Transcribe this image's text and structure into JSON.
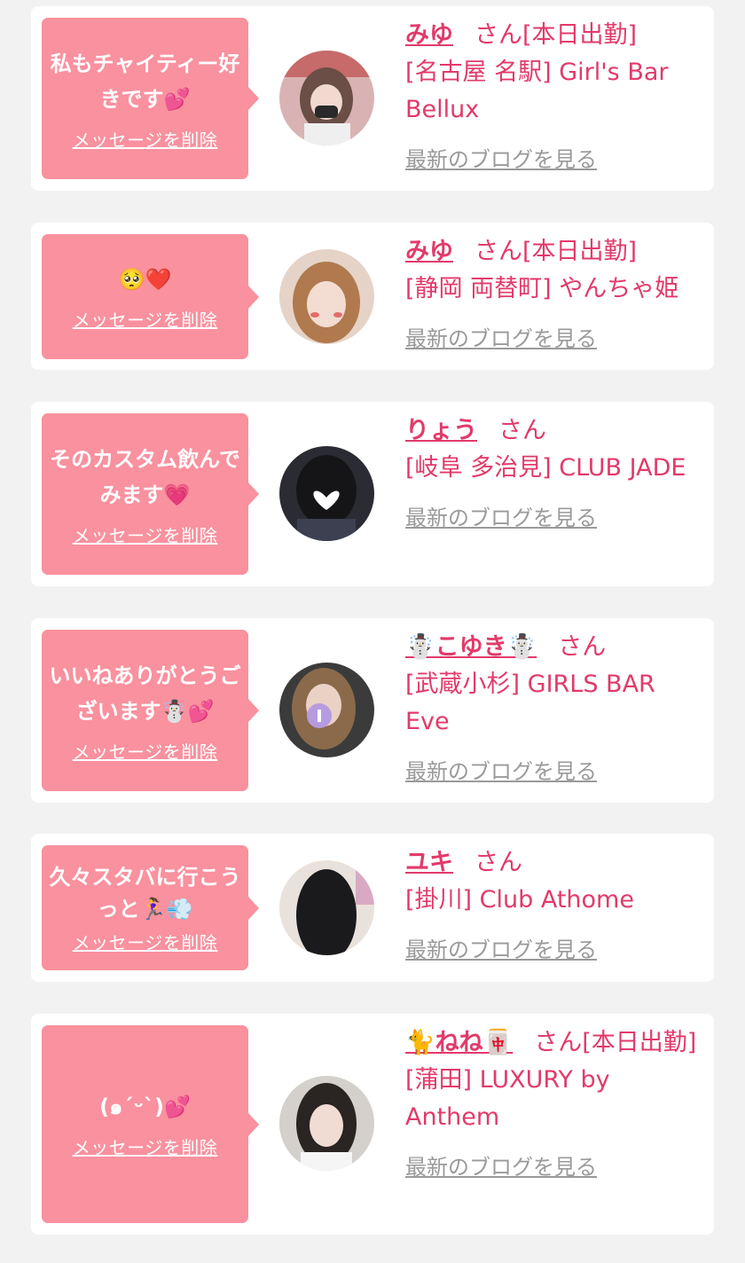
{
  "delete_label": "メッセージを削除",
  "honorific": "さん",
  "blog_label": "最新のブログを見る",
  "colors": {
    "background": "#f2f2f2",
    "bubble": "#f9919e",
    "accent": "#e23a6a",
    "link_gray": "#9a9a9a"
  },
  "items": [
    {
      "message": "私もチャイティー好きです💕",
      "cast_name": "みゆ",
      "status": "[本日出勤]",
      "shop": "[名古屋 名駅] Girl's Bar Bellux"
    },
    {
      "message": "🥺❤️",
      "cast_name": "みゆ",
      "status": "[本日出勤]",
      "shop": "[静岡 両替町] やんちゃ姫"
    },
    {
      "message": "そのカスタム飲んでみます💗",
      "cast_name": "りょう",
      "status": "",
      "shop": "[岐阜 多治見] CLUB JADE"
    },
    {
      "message": "いいねありがとうございます☃️💕",
      "cast_name": "☃️こゆき☃️",
      "status": "",
      "shop": "[武蔵小杉] GIRLS BAR Eve"
    },
    {
      "message": "久々スタバに行こうっと🏃‍♀️💨",
      "cast_name": "ユキ",
      "status": "",
      "shop": "[掛川] Club Athome"
    },
    {
      "message": "(๑´ᵕ`)💕",
      "cast_name": "🐈ねね🀄",
      "status": "[本日出勤]",
      "shop": "[蒲田] LUXURY by Anthem"
    }
  ]
}
